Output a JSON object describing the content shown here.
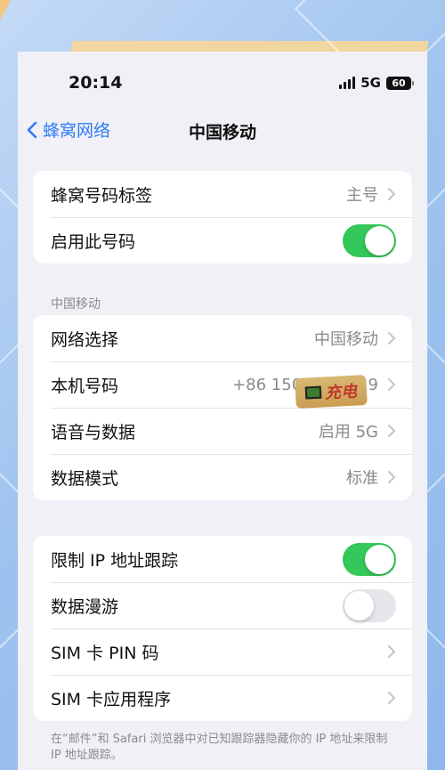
{
  "status_bar": {
    "time": "20:14",
    "network": "5G",
    "battery": "60"
  },
  "nav": {
    "back_label": "蜂窝网络",
    "title": "中国移动"
  },
  "group1": [
    {
      "label": "蜂窝号码标签",
      "value": "主号"
    },
    {
      "label": "启用此号码",
      "toggle": true
    }
  ],
  "section2_header": "中国移动",
  "group2": [
    {
      "label": "网络选择",
      "value": "中国移动"
    },
    {
      "label": "本机号码",
      "value": "+86 150 0          9"
    },
    {
      "label": "语音与数据",
      "value": "启用 5G"
    },
    {
      "label": "数据模式",
      "value": "标准"
    }
  ],
  "group3": [
    {
      "label": "限制 IP 地址跟踪",
      "toggle": true
    },
    {
      "label": "数据漫游",
      "toggle": false
    },
    {
      "label": "SIM 卡 PIN 码"
    },
    {
      "label": "SIM 卡应用程序"
    }
  ],
  "footer_text": "在“邮件”和 Safari 浏览器中对已知跟踪器隐藏你的 IP 地址来限制 IP 地址跟踪。",
  "watermark": "充电",
  "colors": {
    "accent": "#2f7cf6",
    "toggle_on": "#34c759"
  }
}
